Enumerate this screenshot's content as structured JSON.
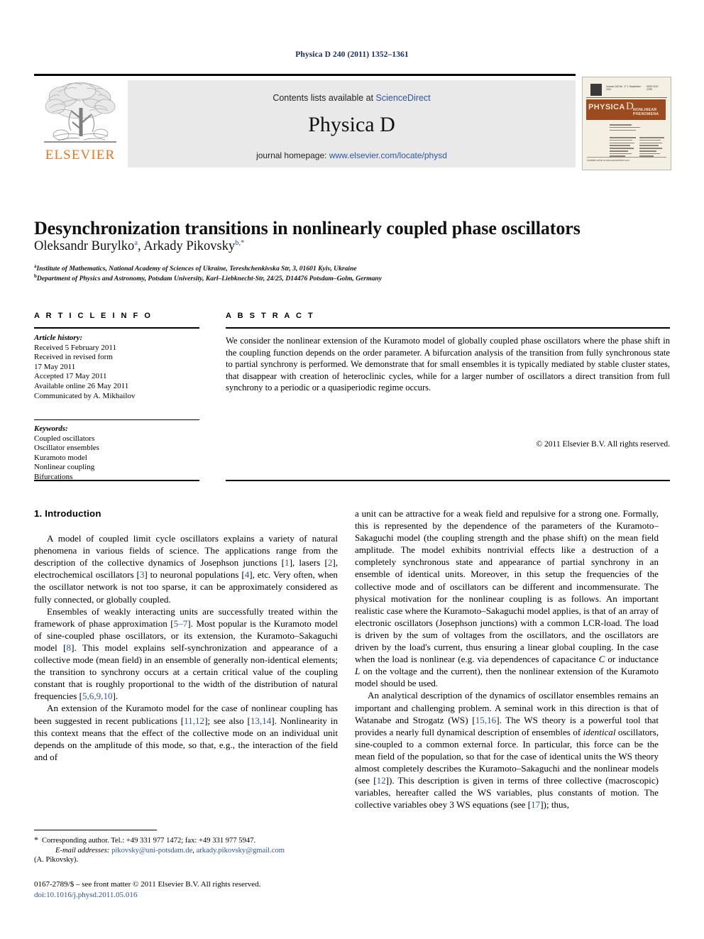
{
  "running_head": "Physica D 240 (2011) 1352–1361",
  "masthead": {
    "contents_prefix": "Contents lists available at ",
    "sciencedirect": "ScienceDirect",
    "journal_title": "Physica D",
    "homepage_prefix": "journal homepage: ",
    "homepage_url": "www.elsevier.com/locate/physd",
    "publisher_wordmark": "ELSEVIER",
    "publisher_color": "#e87722"
  },
  "cover": {
    "issue_line": "Volume 240  No. 17  1 September 2011",
    "issn_line": "ISSN 0167-2789",
    "band_title": "PHYSICA",
    "band_letter": "D",
    "band_subtitle": "NONLINEAR PHENOMENA",
    "band_color": "#9c4a20",
    "footer_note": "Available online at www.sciencedirect.com"
  },
  "article": {
    "title": "Desynchronization transitions in nonlinearly coupled phase oscillators",
    "authors": [
      {
        "name": "Oleksandr Burylko",
        "marker": "a"
      },
      {
        "name": "Arkady Pikovsky",
        "marker": "b,*"
      }
    ],
    "authors_line": "Oleksandr Burylko",
    "author2_line": ", Arkady Pikovsky",
    "affiliations": [
      {
        "marker": "a",
        "text": "Institute of Mathematics, National Academy of Sciences of Ukraine, Tereshchenkivska Str, 3, 01601 Kyiv, Ukraine"
      },
      {
        "marker": "b",
        "text": "Department of Physics and Astronomy, Potsdam University, Karl–Liebknecht-Str, 24/25, D14476 Potsdam–Golm, Germany"
      }
    ]
  },
  "info_section": {
    "label": "A R T I C L E    I N F O",
    "history_heading": "Article history:",
    "history": [
      "Received 5 February 2011",
      "Received in revised form",
      "17 May 2011",
      "Accepted 17 May 2011",
      "Available online 26 May 2011",
      "Communicated by A. Mikhailov"
    ],
    "keywords_heading": "Keywords:",
    "keywords": [
      "Coupled oscillators",
      "Oscillator ensembles",
      "Kuramoto model",
      "Nonlinear coupling",
      "Bifurcations"
    ]
  },
  "abstract_section": {
    "label": "A B S T R A C T",
    "text": "We consider the nonlinear extension of the Kuramoto model of globally coupled phase oscillators where the phase shift in the coupling function depends on the order parameter. A bifurcation analysis of the transition from fully synchronous state to partial synchrony is performed. We demonstrate that for small ensembles it is typically mediated by stable cluster states, that disappear with creation of heteroclinic cycles, while for a larger number of oscillators a direct transition from full synchrony to a periodic or a quasiperiodic regime occurs.",
    "copyright": "© 2011 Elsevier B.V. All rights reserved."
  },
  "body": {
    "section_number_title": "1.  Introduction",
    "left_paragraphs": [
      {
        "parts": [
          {
            "t": "A model of coupled limit cycle oscillators explains a variety of natural phenomena in various fields of science. The applications range from the description of the collective dynamics of Josephson junctions ["
          },
          {
            "t": "1",
            "k": "ref"
          },
          {
            "t": "], lasers ["
          },
          {
            "t": "2",
            "k": "ref"
          },
          {
            "t": "], electrochemical oscillators ["
          },
          {
            "t": "3",
            "k": "ref"
          },
          {
            "t": "] to neuronal populations ["
          },
          {
            "t": "4",
            "k": "ref"
          },
          {
            "t": "], etc. Very often, when the oscillator network is not too sparse, it can be approximately considered as fully connected, or globally coupled."
          }
        ]
      },
      {
        "parts": [
          {
            "t": "Ensembles of weakly interacting units are successfully treated within the framework of phase approximation ["
          },
          {
            "t": "5–7",
            "k": "ref"
          },
          {
            "t": "]. Most popular is the Kuramoto model of sine-coupled phase oscillators, or its extension, the Kuramoto–Sakaguchi model ["
          },
          {
            "t": "8",
            "k": "ref"
          },
          {
            "t": "]. This model explains self-synchronization and appearance of a collective mode (mean field) in an ensemble of generally non-identical elements; the transition to synchrony occurs at a certain critical value of the coupling constant that is roughly proportional to the width of the distribution of natural frequencies ["
          },
          {
            "t": "5,6,9,10",
            "k": "ref"
          },
          {
            "t": "]."
          }
        ]
      },
      {
        "parts": [
          {
            "t": "An extension of the Kuramoto model for the case of nonlinear coupling has been suggested in recent publications ["
          },
          {
            "t": "11,12",
            "k": "ref"
          },
          {
            "t": "]; see also ["
          },
          {
            "t": "13,14",
            "k": "ref"
          },
          {
            "t": "]. Nonlinearity in this context means that the effect of the collective mode on an individual unit depends on the amplitude of this mode, so that, e.g., the interaction of the field and of"
          }
        ]
      }
    ],
    "right_paragraphs": [
      {
        "indent": false,
        "parts": [
          {
            "t": "a unit can be attractive for a weak field and repulsive for a strong one. Formally, this is represented by the dependence of the parameters of the Kuramoto–Sakaguchi model (the coupling strength and the phase shift) on the mean field amplitude. The model exhibits nontrivial effects like a destruction of a completely synchronous state and appearance of partial synchrony in an ensemble of identical units. Moreover, in this setup the frequencies of the collective mode and of oscillators can be different and incommensurate. The physical motivation for the nonlinear coupling is as follows. An important realistic case where the Kuramoto–Sakaguchi model applies, is that of an array of electronic oscillators (Josephson junctions) with a common LCR-load. The load is driven by the sum of voltages from the oscillators, and the oscillators are driven by the load's current, thus ensuring a linear global coupling. In the case when the load is nonlinear (e.g. via dependences of capacitance "
          },
          {
            "t": "C",
            "k": "it"
          },
          {
            "t": " or inductance "
          },
          {
            "t": "L",
            "k": "it"
          },
          {
            "t": " on the voltage and the current), then the nonlinear extension of the Kuramoto model should be used."
          }
        ]
      },
      {
        "indent": true,
        "parts": [
          {
            "t": "An analytical description of the dynamics of oscillator ensembles remains an important and challenging problem. A seminal work in this direction is that of Watanabe and Strogatz (WS) ["
          },
          {
            "t": "15,16",
            "k": "ref"
          },
          {
            "t": "]. The WS theory is a powerful tool that provides a nearly full dynamical description of ensembles of "
          },
          {
            "t": "identical",
            "k": "it"
          },
          {
            "t": " oscillators, sine-coupled to a common external force. In particular, this force can be the mean field of the population, so that for the case of identical units the WS theory almost completely describes the Kuramoto–Sakaguchi and the nonlinear models (see ["
          },
          {
            "t": "12",
            "k": "ref"
          },
          {
            "t": "]). This description is given in terms of three collective (macroscopic) variables, hereafter called the WS variables, plus constants of motion. The collective variables obey 3 WS equations (see ["
          },
          {
            "t": "17",
            "k": "ref"
          },
          {
            "t": "]); thus,"
          }
        ]
      }
    ]
  },
  "footnotes": {
    "corresponding": "Corresponding author. Tel.: +49 331 977 1472; fax: +49 331 977 5947.",
    "email_label": "E-mail addresses:",
    "email1": "pikovsky@uni-potsdam.de",
    "email_sep": ", ",
    "email2": "arkady.pikovsky@gmail.com",
    "email_attrib": "(A. Pikovsky).",
    "frontmatter": "0167-2789/$ – see front matter © 2011 Elsevier B.V. All rights reserved.",
    "doi": "doi:10.1016/j.physd.2011.05.016"
  }
}
